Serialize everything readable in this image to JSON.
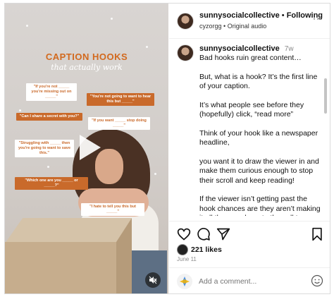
{
  "media": {
    "headline": "CAPTION HOOKS",
    "subline": "that actually work",
    "hooks": [
      "\"If you're not _____ you're missing out on _____\"",
      "\"You're not going to want to hear this but _____\"",
      "\"Can I share a secret with you?\"",
      "\"If you want _____ stop doing _____\"",
      "\"Struggling with _____ then you're going to want to save this.\"",
      "\"Which one are you _____ or _____?\"",
      "\"I hate to tell you this but _____\""
    ],
    "icons": {
      "play": "play-icon",
      "mute": "mute-icon"
    }
  },
  "header": {
    "username": "sunnysocialcollective",
    "separator": "•",
    "follow_label": "Following",
    "audio_user": "cyzorgg",
    "audio_label": "Original audio",
    "more_label": "···"
  },
  "caption": {
    "username": "sunnysocialcollective",
    "time": "7w",
    "paragraphs": [
      "Bad hooks ruin great content…",
      "But, what is a hook? It’s the first line of your caption.",
      "It’s what people see before they (hopefully) click, “read more”",
      "Think of your hook like a newspaper headline,",
      "you want it to draw the viewer in and make them curious enough to stop their scroll and keep reading!",
      "If the viewer isn’t getting past the hook chances are they aren’t making it all the way down to the call to action, which means you are probs"
    ]
  },
  "actions": {
    "like_icon": "heart-icon",
    "comment_icon": "comment-icon",
    "share_icon": "share-icon",
    "save_icon": "bookmark-icon"
  },
  "likes": {
    "count_label": "221 likes"
  },
  "date": "June 11",
  "comment": {
    "placeholder": "Add a comment..."
  },
  "colors": {
    "accent": "#c96a2b",
    "muted": "#8e8e8e",
    "border": "#dbdbdb"
  }
}
